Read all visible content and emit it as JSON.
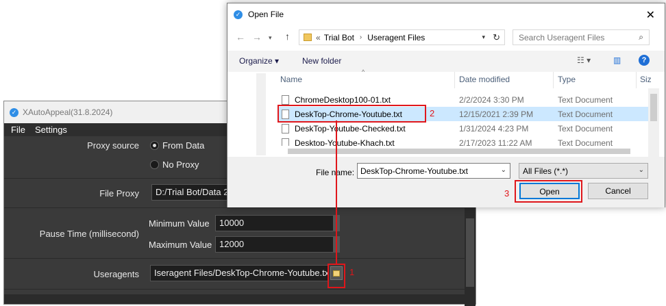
{
  "app": {
    "title": "XAutoAppeal(31.8.2024)",
    "menu": [
      "File",
      "Settings"
    ],
    "proxy_source_label": "Proxy source",
    "proxy_options": [
      "From Data",
      "No Proxy"
    ],
    "file_proxy_label": "File Proxy",
    "file_proxy_value": "D:/Trial Bot/Data 2",
    "pause_time_label": "Pause Time (millisecond)",
    "min_label": "Minimum Value",
    "min_value": "10000",
    "max_label": "Maximum Value",
    "max_value": "12000",
    "useragents_label": "Useragents",
    "useragents_value": "Iseragent Files/DeskTop-Chrome-Youtube.txt"
  },
  "dialog": {
    "title": "Open File",
    "breadcrumb": [
      "«",
      "Trial Bot",
      "Useragent Files"
    ],
    "search_placeholder": "Search Useragent Files",
    "organize_label": "Organize ▾",
    "new_folder_label": "New folder",
    "columns": [
      "Name",
      "Date modified",
      "Type",
      "Siz"
    ],
    "files": [
      {
        "name": "ChromeDesktop100-01.txt",
        "date": "2/2/2024 3:30 PM",
        "type": "Text Document"
      },
      {
        "name": "DeskTop-Chrome-Youtube.txt",
        "date": "12/15/2021 2:39 PM",
        "type": "Text Document"
      },
      {
        "name": "DeskTop-Youtube-Checked.txt",
        "date": "1/31/2024 4:23 PM",
        "type": "Text Document"
      },
      {
        "name": "Desktop-Youtube-Khach.txt",
        "date": "2/17/2023 11:22 AM",
        "type": "Text Document"
      }
    ],
    "file_name_label": "File name:",
    "file_name_value": "DeskTop-Chrome-Youtube.txt",
    "file_type_value": "All Files (*.*)",
    "open_label": "Open",
    "cancel_label": "Cancel"
  },
  "annotations": {
    "step1": "1",
    "step2": "2",
    "step3": "3"
  }
}
